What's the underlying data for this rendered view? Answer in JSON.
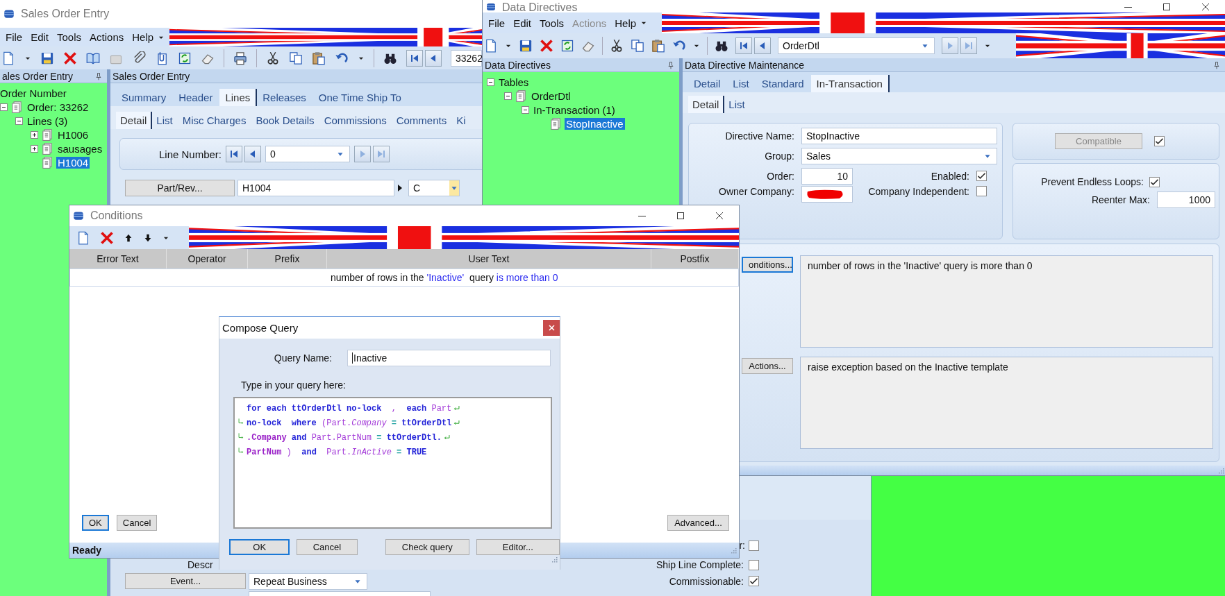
{
  "sales_order_entry": {
    "title": "Sales Order Entry",
    "menu": [
      {
        "label": "File",
        "disabled": false
      },
      {
        "label": "Edit",
        "disabled": false
      },
      {
        "label": "Tools",
        "disabled": false
      },
      {
        "label": "Actions",
        "disabled": false
      },
      {
        "label": "Help",
        "disabled": false
      }
    ],
    "record_field": "33262",
    "tree_panel_title": "ales Order Entry",
    "tree_root": "Order Number",
    "tree": [
      {
        "label": "Order: 33262",
        "icon": true,
        "expanded": true,
        "selected": false,
        "children": [
          {
            "label": "Lines (3)",
            "icon": false,
            "expanded": true,
            "selected": false,
            "children": [
              {
                "label": "H1006",
                "icon": true,
                "expanded": false,
                "selected": false
              },
              {
                "label": "sausages",
                "icon": true,
                "expanded": false,
                "selected": false
              },
              {
                "label": "H1004",
                "icon": true,
                "selected": true
              }
            ]
          }
        ]
      }
    ],
    "panel_title": "Sales Order Entry",
    "tabs": [
      {
        "label": "Summary",
        "selected": false
      },
      {
        "label": "Header",
        "selected": false
      },
      {
        "label": "Lines",
        "selected": true
      },
      {
        "label": "Releases",
        "selected": false
      },
      {
        "label": "One Time Ship To",
        "selected": false
      }
    ],
    "subtabs": [
      {
        "label": "Detail",
        "selected": true
      },
      {
        "label": "List",
        "selected": false
      },
      {
        "label": "Misc Charges",
        "selected": false
      },
      {
        "label": "Book Details",
        "selected": false
      },
      {
        "label": "Commissions",
        "selected": false
      },
      {
        "label": "Comments",
        "selected": false
      },
      {
        "label": "Ki",
        "selected": false
      }
    ],
    "line_number_label": "Line Number:",
    "line_number": "0",
    "part_button": "Part/Rev...",
    "part": "H1004",
    "revision": "C",
    "description_label": "Descr",
    "event_button": "Event...",
    "event": "Repeat Business",
    "flags": [
      {
        "label": "r:",
        "checked": false
      },
      {
        "label": "Ship Line Complete:",
        "checked": false
      },
      {
        "label": "Commissionable:",
        "checked": true
      }
    ]
  },
  "data_directives": {
    "title": "Data Directives",
    "menu": [
      {
        "label": "File",
        "disabled": false
      },
      {
        "label": "Edit",
        "disabled": false
      },
      {
        "label": "Tools",
        "disabled": false
      },
      {
        "label": "Actions",
        "disabled": true
      },
      {
        "label": "Help",
        "disabled": false
      }
    ],
    "table_field": "OrderDtl",
    "tree_panel_title": "Data Directives",
    "tree": [
      {
        "label": "Tables",
        "icon": false,
        "expanded": true,
        "selected": false,
        "children": [
          {
            "label": "OrderDtl",
            "icon": true,
            "expanded": true,
            "selected": false,
            "children": [
              {
                "label": "In-Transaction (1)",
                "icon": false,
                "expanded": true,
                "selected": false,
                "children": [
                  {
                    "label": "StopInactive",
                    "icon": true,
                    "selected": true
                  }
                ]
              }
            ]
          }
        ]
      }
    ],
    "panel_title": "Data Directive Maintenance",
    "tabs": [
      {
        "label": "Detail",
        "selected": false
      },
      {
        "label": "List",
        "selected": false
      },
      {
        "label": "Standard",
        "selected": false
      },
      {
        "label": "In-Transaction",
        "selected": true
      }
    ],
    "subtabs": [
      {
        "label": "Detail",
        "selected": true
      },
      {
        "label": "List",
        "selected": false
      }
    ],
    "directive_name_label": "Directive Name:",
    "directive_name": "StopInactive",
    "group_label": "Group:",
    "group": "Sales",
    "order_label": "Order:",
    "order": "10",
    "enabled": {
      "label": "Enabled:",
      "checked": true
    },
    "owner_company_label": "Owner Company:",
    "company_independent": {
      "label": "Company Independent:",
      "checked": false
    },
    "compatible": {
      "label": "Compatible",
      "disabled": true,
      "checked": true
    },
    "prevent_endless_loops": {
      "label": "Prevent Endless Loops:",
      "checked": true
    },
    "reenter_max_label": "Reenter Max:",
    "reenter_max": "1000",
    "conditions_button": {
      "label": "onditions...",
      "focused": true
    },
    "conditions_text": "number of rows in the 'Inactive' query is more than 0",
    "actions_button": {
      "label": "Actions...",
      "focused": false
    },
    "actions_text": "raise exception based on the Inactive template"
  },
  "conditions": {
    "title": "Conditions",
    "columns": [
      "Error Text",
      "Operator",
      "Prefix",
      "User Text",
      "Postfix"
    ],
    "rows": [
      {
        "user_text": [
          {
            "text": "number of rows in the ",
            "kind": "plain"
          },
          {
            "text": "'Inactive'",
            "kind": "link"
          },
          {
            "text": "  query ",
            "kind": "plain"
          },
          {
            "text": "is more than 0",
            "kind": "link"
          }
        ]
      }
    ],
    "buttons": [
      {
        "label": "OK",
        "focused": true
      },
      {
        "label": "Cancel",
        "focused": false
      }
    ],
    "advanced_button": "Advanced...",
    "status": "Ready"
  },
  "compose_query": {
    "title": "Compose Query",
    "query_name_label": "Query Name:",
    "query_name": "Inactive",
    "prompt": "Type in your query here:",
    "code_lines": [
      {
        "continued": false,
        "wrapped": true,
        "tokens": [
          {
            "text": "for each ttOrderDtl no-lock  ",
            "kind": "keyword"
          },
          {
            "text": ",",
            "kind": "name"
          },
          {
            "text": "  each ",
            "kind": "keyword"
          },
          {
            "text": "Part",
            "kind": "name"
          }
        ]
      },
      {
        "continued": true,
        "wrapped": true,
        "tokens": [
          {
            "text": "no-lock  where ",
            "kind": "keyword"
          },
          {
            "text": "(Part.",
            "kind": "name"
          },
          {
            "text": "Company",
            "kind": "field"
          },
          {
            "text": " = ",
            "kind": "operator"
          },
          {
            "text": "ttOrderDtl",
            "kind": "keyword"
          }
        ]
      },
      {
        "continued": true,
        "wrapped": true,
        "tokens": [
          {
            "text": ".Company",
            "kind": "strong_name"
          },
          {
            "text": " and ",
            "kind": "keyword"
          },
          {
            "text": "Part.PartNum",
            "kind": "name"
          },
          {
            "text": " = ",
            "kind": "operator"
          },
          {
            "text": "ttOrderDtl.",
            "kind": "keyword"
          }
        ]
      },
      {
        "continued": true,
        "wrapped": false,
        "tokens": [
          {
            "text": "PartNum",
            "kind": "strong_name"
          },
          {
            "text": " ) ",
            "kind": "name"
          },
          {
            "text": " and  ",
            "kind": "keyword"
          },
          {
            "text": "Part.",
            "kind": "name"
          },
          {
            "text": "InActive",
            "kind": "field"
          },
          {
            "text": " = ",
            "kind": "operator"
          },
          {
            "text": "TRUE",
            "kind": "keyword"
          }
        ]
      }
    ],
    "buttons": [
      {
        "label": "OK",
        "focused": true
      },
      {
        "label": "Cancel",
        "focused": false
      }
    ],
    "query_buttons": [
      {
        "label": "Check query",
        "focused": false
      },
      {
        "label": "Editor...",
        "focused": false
      }
    ]
  }
}
